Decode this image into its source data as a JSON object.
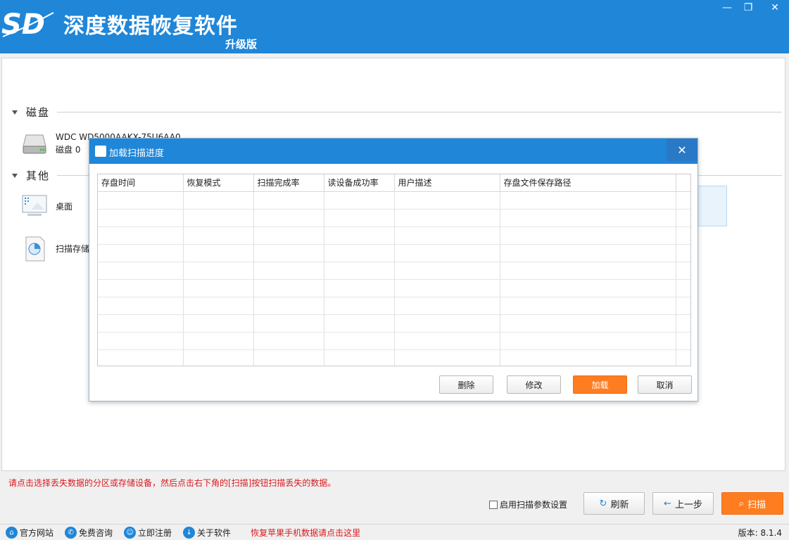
{
  "app": {
    "title": "深度数据恢复软件",
    "subtitle": "升级版",
    "logo_text": "SD"
  },
  "window": {
    "min": "—",
    "restore": "❐",
    "close": "✕"
  },
  "sections": {
    "disk": {
      "label": "磁盘"
    },
    "other": {
      "label": "其他"
    }
  },
  "disk_device": {
    "name": "WDC WD5000AAKX-75U6AA0",
    "sub": "磁盘 0"
  },
  "other_items": [
    {
      "label": "桌面",
      "icon": "desktop-icon"
    },
    {
      "label": "扫描存储",
      "icon": "scan-storage-icon"
    }
  ],
  "dialog": {
    "title": "加载扫描进度",
    "close": "✕",
    "columns": [
      "存盘时间",
      "恢复模式",
      "扫描完成率",
      "读设备成功率",
      "用户描述",
      "存盘文件保存路径"
    ],
    "buttons": {
      "delete": "删除",
      "modify": "修改",
      "load": "加载",
      "cancel": "取消"
    }
  },
  "hint": "请点击选择丢失数据的分区或存储设备，然后点击右下角的[扫描]按钮扫描丢失的数据。",
  "controls": {
    "checkbox_label": "启用扫描参数设置",
    "refresh": "刷新",
    "prev": "上一步",
    "scan": "扫描"
  },
  "statusbar": {
    "items": [
      {
        "label": "官方网站",
        "icon": "home-icon"
      },
      {
        "label": "免费咨询",
        "icon": "chat-icon"
      },
      {
        "label": "立即注册",
        "icon": "register-icon"
      },
      {
        "label": "关于软件",
        "icon": "info-icon"
      }
    ],
    "promo": "恢复苹果手机数据请点击这里",
    "version": "版本: 8.1.4"
  },
  "colors": {
    "brand_blue": "#1f86d8",
    "accent_orange": "#ff7d21",
    "hint_red": "#d7191f"
  }
}
